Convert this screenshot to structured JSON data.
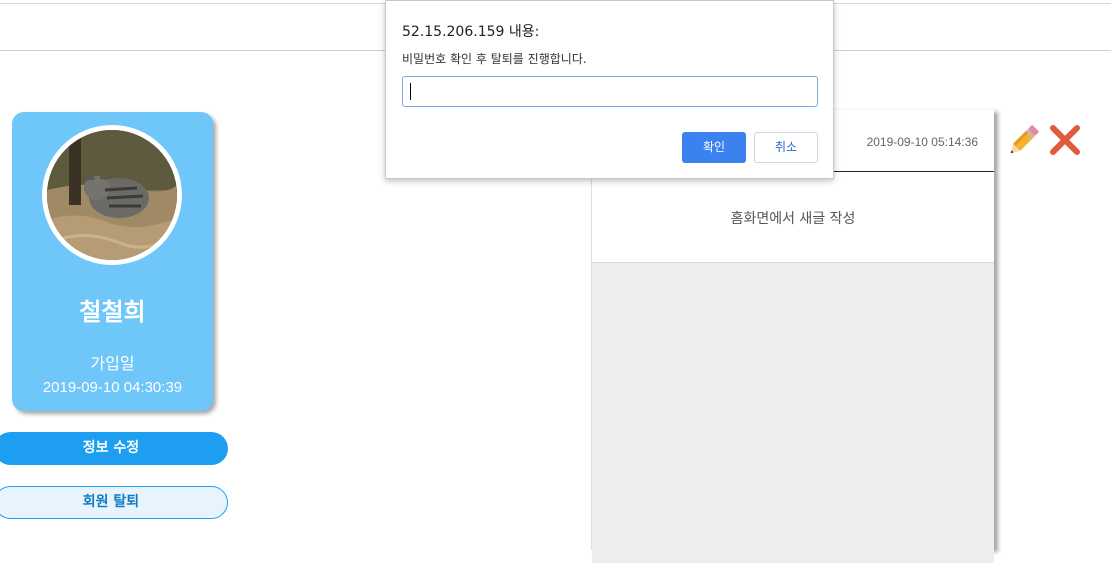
{
  "dialog": {
    "title": "52.15.206.159 내용:",
    "message": "비밀번호 확인 후 탈퇴를 진행합니다.",
    "input_value": "",
    "ok_label": "확인",
    "cancel_label": "취소"
  },
  "profile": {
    "name": "철철희",
    "join_label": "가입일",
    "join_date": "2019-09-10 04:30:39",
    "card_color": "#6ec6f9"
  },
  "actions": {
    "edit_info_label": "정보 수정",
    "withdraw_label": "회원 탈퇴",
    "accent_color": "#1e9ef0"
  },
  "post": {
    "date": "2019-09-10 05:14:36",
    "content": "홈화면에서 새글 작성",
    "edit_icon": "pencil-icon",
    "delete_icon": "close-icon"
  }
}
